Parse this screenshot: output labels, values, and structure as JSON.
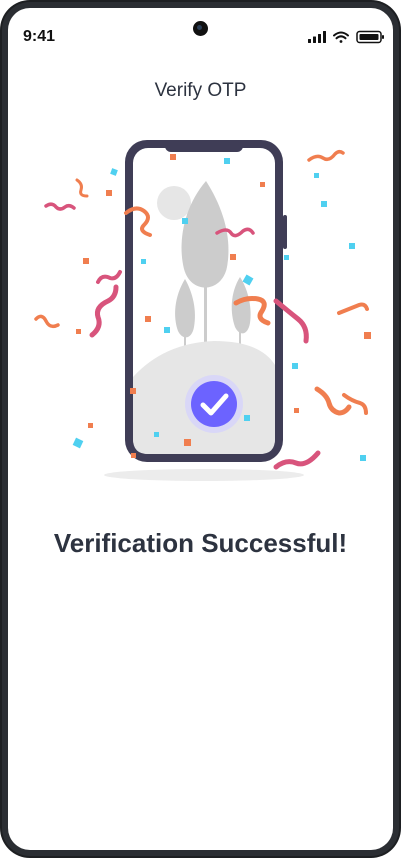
{
  "status_bar": {
    "time": "9:41"
  },
  "header": {
    "title": "Verify OTP"
  },
  "main": {
    "headline": "Verification Successful!"
  },
  "colors": {
    "accent": "#6C63FF",
    "phone_frame": "#3F3D56",
    "confetti_orange": "#F07E4F",
    "confetti_pink": "#D8547C",
    "confetti_cyan": "#4FD0F0",
    "text": "#2D3340"
  },
  "icons": [
    "signal-icon",
    "wifi-icon",
    "battery-icon",
    "checkmark-badge-icon",
    "phone-illustration",
    "confetti-decoration"
  ]
}
